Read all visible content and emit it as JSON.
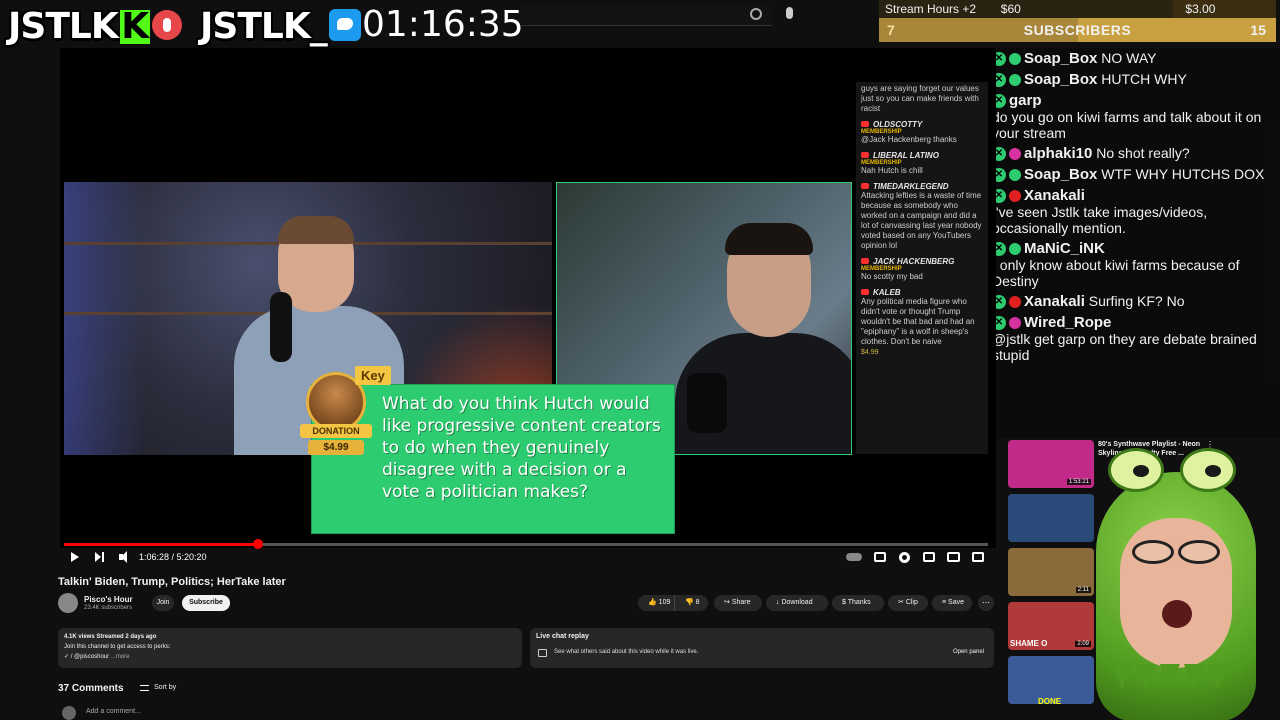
{
  "overlay": {
    "brand_left": "JSTLK",
    "kick_letter": "K",
    "brand_right": "JSTLK_",
    "clock": "01:16:35"
  },
  "stats": {
    "stream_hours_label": "Stream Hours +2",
    "amount_mid": "$3.00",
    "amount_right": "$60",
    "subs_current": "7",
    "subs_label": "SUBSCRIBERS",
    "subs_goal": "15"
  },
  "chat": [
    {
      "user": "Soap_Box",
      "msg": "NO WAY",
      "color": "#2ecc71",
      "same_line": true
    },
    {
      "user": "Soap_Box",
      "msg": "HUTCH WHY",
      "color": "#2ecc71",
      "same_line": true
    },
    {
      "user": "garp",
      "msg": "do you go on kiwi farms and talk about it on your stream",
      "color": "",
      "same_line": false
    },
    {
      "user": "alphaki10",
      "msg": "No shot really?",
      "color": "#d633a0",
      "same_line": true
    },
    {
      "user": "Soap_Box",
      "msg": "WTF WHY HUTCHS DOX",
      "color": "#2ecc71",
      "same_line": true
    },
    {
      "user": "Xanakali",
      "msg": "I've seen Jstlk take images/videos, occasionally mention.",
      "color": "#e02020",
      "same_line": false
    },
    {
      "user": "MaNiC_iNK",
      "msg": "I only know about kiwi farms because of Destiny",
      "color": "#2ecc71",
      "same_line": false
    },
    {
      "user": "Xanakali",
      "msg": "Surfing KF? No",
      "color": "#e02020",
      "same_line": true
    },
    {
      "user": "Wired_Rope",
      "msg": "@jstlk get garp on they are debate brained stupid",
      "color": "#d633a0",
      "same_line": false
    }
  ],
  "yt_chat": {
    "top_text": "guys are saying forget our values just so you can make friends with racist",
    "entries": [
      {
        "name": "OLDSCOTTY",
        "badge": "MEMBERSHIP",
        "msg": "@Jack Hackenberg thanks",
        "price": ""
      },
      {
        "name": "LIBERAL LATINO",
        "badge": "MEMBERSHIP",
        "msg": "Nah Hutch is chill",
        "price": ""
      },
      {
        "name": "TIMEDARKLEGEND",
        "badge": "",
        "msg": "Attacking lefties is a waste of time because as somebody who worked on a campaign and did a lot of canvassing last year nobody voted based on any YouTubers opinion lol",
        "price": ""
      },
      {
        "name": "JACK HACKENBERG",
        "badge": "MEMBERSHIP",
        "msg": "No scotty my bad",
        "price": ""
      },
      {
        "name": "KALEB",
        "badge": "",
        "msg": "Any political media figure who didn't vote or thought Trump wouldn't be that bad and had an \"epiphany\" is a wolf in sheep's clothes. Don't be naive",
        "price": "$4.99"
      }
    ]
  },
  "donation": {
    "donor": "Key",
    "badge_label": "DONATION",
    "amount": "$4.99",
    "message": "What do you think Hutch would like progressive content creators to do when they genuinely disagree with a decision or a vote a politician makes?"
  },
  "player": {
    "time": "1:06:28 / 5:20:20",
    "progress": 0.21
  },
  "video": {
    "title": "Talkin' Biden, Trump, Politics; HerTake later",
    "channel": "Pisco's Hour",
    "subscribers": "23.4K subscribers",
    "join_label": "Join",
    "subscribe_label": "Subscribe",
    "likes": "109",
    "dislikes": "8",
    "share": "Share",
    "download": "Download",
    "thanks": "Thanks",
    "clip": "Clip",
    "save": "Save",
    "more": "⋯"
  },
  "description": {
    "stats": "4.1K views  Streamed 2 days ago",
    "line2": "Join this channel to get access to perks:",
    "line3": "✓ / @piscoshour",
    "more": "...more"
  },
  "live_chat_replay": {
    "title": "Live chat replay",
    "desc": "See what others said about this video while it was live.",
    "open": "Open panel"
  },
  "comments": {
    "count": "37 Comments",
    "sort": "Sort by",
    "placeholder": "Add a comment..."
  },
  "recommendations": [
    {
      "title": "80's Synthwave Playlist - Neon Skylines // Royalty Free ...",
      "duration": "1:53:21",
      "color": "#c22a8a"
    },
    {
      "title": "",
      "duration": "",
      "color": "#2a4a7a"
    },
    {
      "title": "",
      "duration": "2:11",
      "color": "#8a6a3a"
    },
    {
      "title": "",
      "duration": "2:09",
      "color": "#b03a3a"
    },
    {
      "title": "",
      "duration": "",
      "color": "#3a5a9a"
    }
  ],
  "rec_thumb_texts": [
    "SHAME O",
    "DONE"
  ]
}
